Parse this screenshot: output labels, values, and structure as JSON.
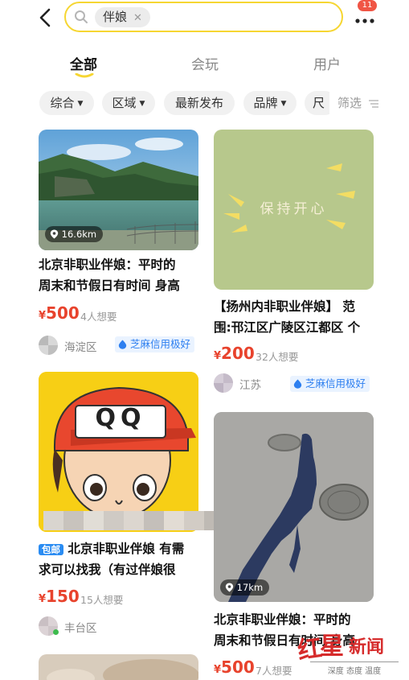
{
  "header": {
    "search_tag": "伴娘",
    "badge_count": "11"
  },
  "tabs": [
    {
      "label": "全部"
    },
    {
      "label": "会玩"
    },
    {
      "label": "用户"
    }
  ],
  "filters": [
    {
      "label": "综合"
    },
    {
      "label": "区域"
    },
    {
      "label": "最新发布"
    },
    {
      "label": "品牌"
    },
    {
      "label": "尺"
    }
  ],
  "filter_right": "筛选",
  "colors": {
    "accent": "#f6d632",
    "price": "#e8432d",
    "credit": "#2d7ff0"
  },
  "cards": [
    {
      "distance": "16.6km",
      "title_line1": "北京非职业伴娘：平时的",
      "title_line2": "周末和节假日有时间 身高",
      "currency": "¥",
      "price": "500",
      "want": "4人想要",
      "region": "海淀区",
      "credit": "芝麻信用极好"
    },
    {
      "image_text": "保持开心",
      "title_line1": "【扬州内非职业伴娘】 范",
      "title_line2": "围:邗江区广陵区江都区 个",
      "currency": "¥",
      "price": "200",
      "want": "32人想要",
      "region": "江苏",
      "credit": "芝麻信用极好"
    },
    {
      "image_text": "QQ",
      "tag": "包邮",
      "title_line1": "北京非职业伴娘 有需",
      "title_line2": "求可以找我（有过伴娘很",
      "currency": "¥",
      "price": "150",
      "want": "15人想要",
      "region": "丰台区"
    },
    {
      "distance": "17km",
      "title_line1": "北京非职业伴娘：平时的",
      "title_line2": "周末和节假日有时间 身高",
      "currency": "¥",
      "price": "500",
      "want": "7人想要"
    }
  ],
  "watermark": {
    "logo_a": "红",
    "logo_b": "星",
    "logo_c": "新闻",
    "sub": "深度 态度 温度"
  }
}
